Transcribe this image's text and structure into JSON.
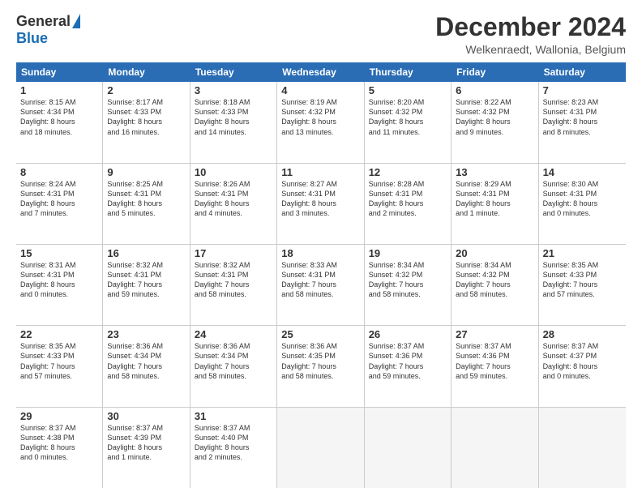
{
  "header": {
    "logo_general": "General",
    "logo_blue": "Blue",
    "month_title": "December 2024",
    "subtitle": "Welkenraedt, Wallonia, Belgium"
  },
  "calendar": {
    "weekdays": [
      "Sunday",
      "Monday",
      "Tuesday",
      "Wednesday",
      "Thursday",
      "Friday",
      "Saturday"
    ],
    "rows": [
      [
        {
          "day": "1",
          "lines": [
            "Sunrise: 8:15 AM",
            "Sunset: 4:34 PM",
            "Daylight: 8 hours",
            "and 18 minutes."
          ]
        },
        {
          "day": "2",
          "lines": [
            "Sunrise: 8:17 AM",
            "Sunset: 4:33 PM",
            "Daylight: 8 hours",
            "and 16 minutes."
          ]
        },
        {
          "day": "3",
          "lines": [
            "Sunrise: 8:18 AM",
            "Sunset: 4:33 PM",
            "Daylight: 8 hours",
            "and 14 minutes."
          ]
        },
        {
          "day": "4",
          "lines": [
            "Sunrise: 8:19 AM",
            "Sunset: 4:32 PM",
            "Daylight: 8 hours",
            "and 13 minutes."
          ]
        },
        {
          "day": "5",
          "lines": [
            "Sunrise: 8:20 AM",
            "Sunset: 4:32 PM",
            "Daylight: 8 hours",
            "and 11 minutes."
          ]
        },
        {
          "day": "6",
          "lines": [
            "Sunrise: 8:22 AM",
            "Sunset: 4:32 PM",
            "Daylight: 8 hours",
            "and 9 minutes."
          ]
        },
        {
          "day": "7",
          "lines": [
            "Sunrise: 8:23 AM",
            "Sunset: 4:31 PM",
            "Daylight: 8 hours",
            "and 8 minutes."
          ]
        }
      ],
      [
        {
          "day": "8",
          "lines": [
            "Sunrise: 8:24 AM",
            "Sunset: 4:31 PM",
            "Daylight: 8 hours",
            "and 7 minutes."
          ]
        },
        {
          "day": "9",
          "lines": [
            "Sunrise: 8:25 AM",
            "Sunset: 4:31 PM",
            "Daylight: 8 hours",
            "and 5 minutes."
          ]
        },
        {
          "day": "10",
          "lines": [
            "Sunrise: 8:26 AM",
            "Sunset: 4:31 PM",
            "Daylight: 8 hours",
            "and 4 minutes."
          ]
        },
        {
          "day": "11",
          "lines": [
            "Sunrise: 8:27 AM",
            "Sunset: 4:31 PM",
            "Daylight: 8 hours",
            "and 3 minutes."
          ]
        },
        {
          "day": "12",
          "lines": [
            "Sunrise: 8:28 AM",
            "Sunset: 4:31 PM",
            "Daylight: 8 hours",
            "and 2 minutes."
          ]
        },
        {
          "day": "13",
          "lines": [
            "Sunrise: 8:29 AM",
            "Sunset: 4:31 PM",
            "Daylight: 8 hours",
            "and 1 minute."
          ]
        },
        {
          "day": "14",
          "lines": [
            "Sunrise: 8:30 AM",
            "Sunset: 4:31 PM",
            "Daylight: 8 hours",
            "and 0 minutes."
          ]
        }
      ],
      [
        {
          "day": "15",
          "lines": [
            "Sunrise: 8:31 AM",
            "Sunset: 4:31 PM",
            "Daylight: 8 hours",
            "and 0 minutes."
          ]
        },
        {
          "day": "16",
          "lines": [
            "Sunrise: 8:32 AM",
            "Sunset: 4:31 PM",
            "Daylight: 7 hours",
            "and 59 minutes."
          ]
        },
        {
          "day": "17",
          "lines": [
            "Sunrise: 8:32 AM",
            "Sunset: 4:31 PM",
            "Daylight: 7 hours",
            "and 58 minutes."
          ]
        },
        {
          "day": "18",
          "lines": [
            "Sunrise: 8:33 AM",
            "Sunset: 4:31 PM",
            "Daylight: 7 hours",
            "and 58 minutes."
          ]
        },
        {
          "day": "19",
          "lines": [
            "Sunrise: 8:34 AM",
            "Sunset: 4:32 PM",
            "Daylight: 7 hours",
            "and 58 minutes."
          ]
        },
        {
          "day": "20",
          "lines": [
            "Sunrise: 8:34 AM",
            "Sunset: 4:32 PM",
            "Daylight: 7 hours",
            "and 58 minutes."
          ]
        },
        {
          "day": "21",
          "lines": [
            "Sunrise: 8:35 AM",
            "Sunset: 4:33 PM",
            "Daylight: 7 hours",
            "and 57 minutes."
          ]
        }
      ],
      [
        {
          "day": "22",
          "lines": [
            "Sunrise: 8:35 AM",
            "Sunset: 4:33 PM",
            "Daylight: 7 hours",
            "and 57 minutes."
          ]
        },
        {
          "day": "23",
          "lines": [
            "Sunrise: 8:36 AM",
            "Sunset: 4:34 PM",
            "Daylight: 7 hours",
            "and 58 minutes."
          ]
        },
        {
          "day": "24",
          "lines": [
            "Sunrise: 8:36 AM",
            "Sunset: 4:34 PM",
            "Daylight: 7 hours",
            "and 58 minutes."
          ]
        },
        {
          "day": "25",
          "lines": [
            "Sunrise: 8:36 AM",
            "Sunset: 4:35 PM",
            "Daylight: 7 hours",
            "and 58 minutes."
          ]
        },
        {
          "day": "26",
          "lines": [
            "Sunrise: 8:37 AM",
            "Sunset: 4:36 PM",
            "Daylight: 7 hours",
            "and 59 minutes."
          ]
        },
        {
          "day": "27",
          "lines": [
            "Sunrise: 8:37 AM",
            "Sunset: 4:36 PM",
            "Daylight: 7 hours",
            "and 59 minutes."
          ]
        },
        {
          "day": "28",
          "lines": [
            "Sunrise: 8:37 AM",
            "Sunset: 4:37 PM",
            "Daylight: 8 hours",
            "and 0 minutes."
          ]
        }
      ],
      [
        {
          "day": "29",
          "lines": [
            "Sunrise: 8:37 AM",
            "Sunset: 4:38 PM",
            "Daylight: 8 hours",
            "and 0 minutes."
          ]
        },
        {
          "day": "30",
          "lines": [
            "Sunrise: 8:37 AM",
            "Sunset: 4:39 PM",
            "Daylight: 8 hours",
            "and 1 minute."
          ]
        },
        {
          "day": "31",
          "lines": [
            "Sunrise: 8:37 AM",
            "Sunset: 4:40 PM",
            "Daylight: 8 hours",
            "and 2 minutes."
          ]
        },
        {
          "day": "",
          "lines": []
        },
        {
          "day": "",
          "lines": []
        },
        {
          "day": "",
          "lines": []
        },
        {
          "day": "",
          "lines": []
        }
      ]
    ]
  }
}
